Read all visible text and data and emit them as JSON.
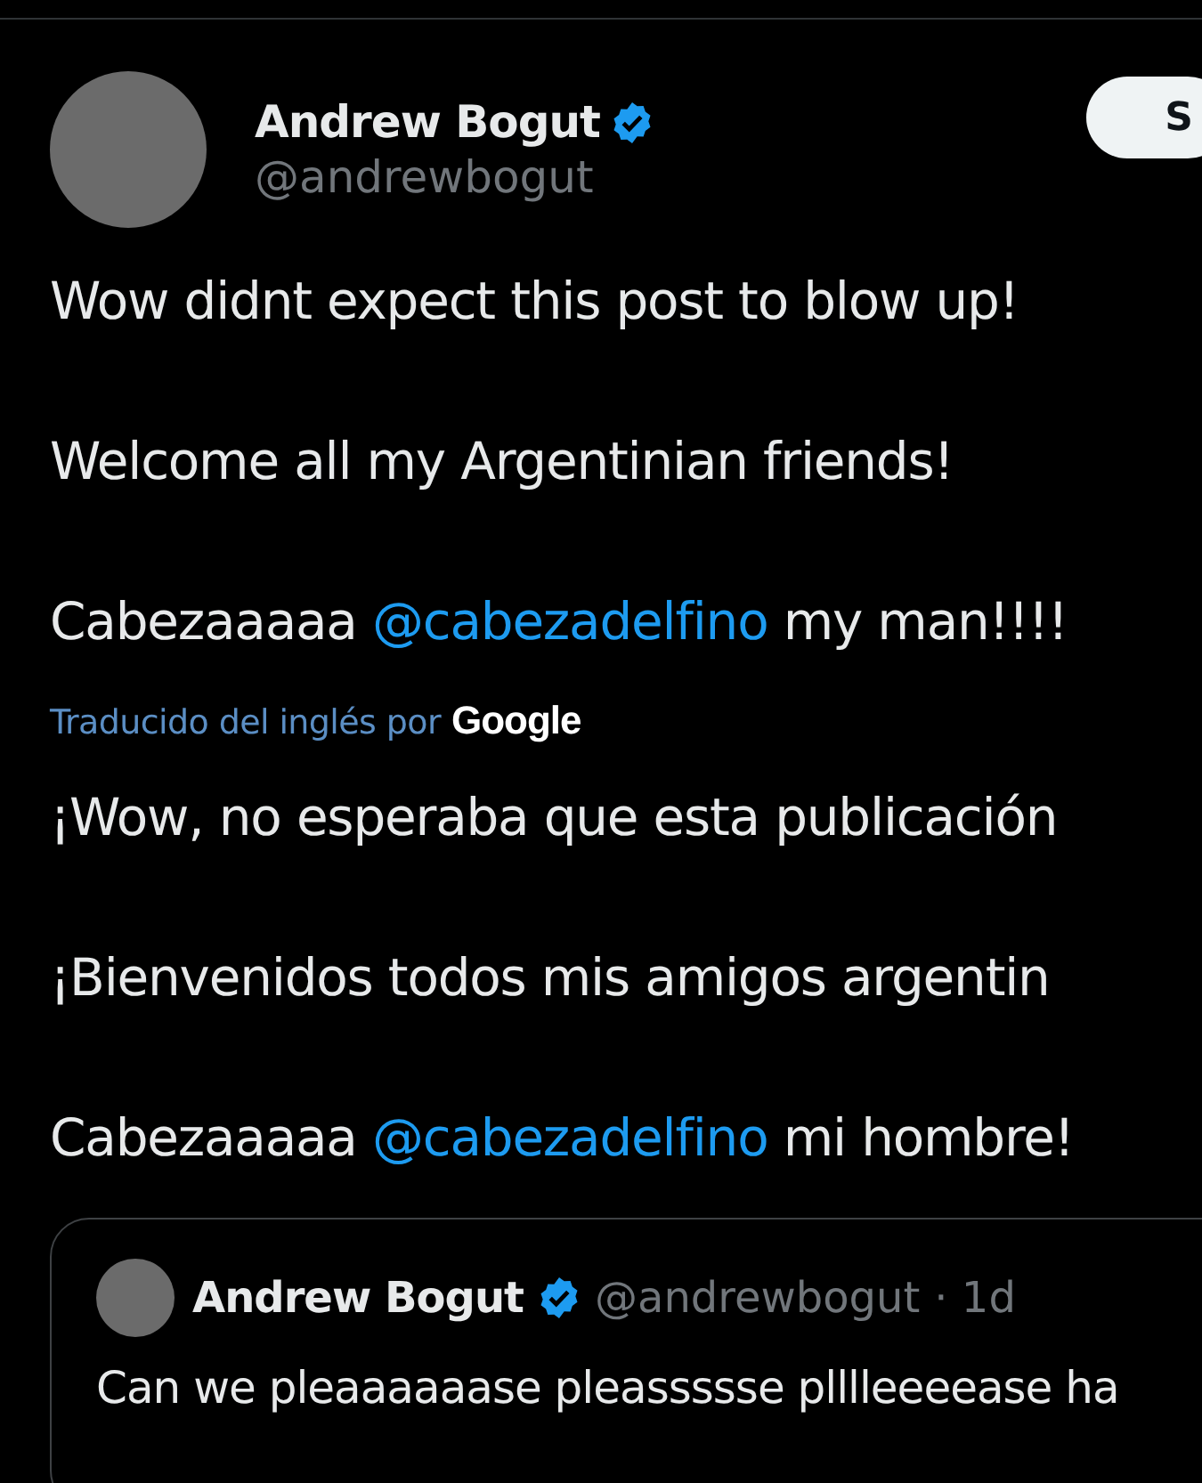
{
  "post": {
    "author": {
      "name": "Andrew Bogut",
      "verified": true,
      "handle": "@andrewbogut"
    },
    "follow_button": {
      "label": "S"
    },
    "paragraphs": [
      {
        "segments": [
          {
            "kind": "text",
            "text": "Wow didnt expect this post to blow up!"
          }
        ]
      },
      {
        "segments": [
          {
            "kind": "text",
            "text": "Welcome all my Argentinian friends!"
          }
        ]
      },
      {
        "segments": [
          {
            "kind": "text",
            "text": "Cabezaaaaa "
          },
          {
            "kind": "mention",
            "text": "@cabezadelfino"
          },
          {
            "kind": "text",
            "text": " my man!!!!"
          }
        ]
      }
    ],
    "translation_note": {
      "label": "Traducido del inglés por",
      "provider": "Google"
    },
    "translated_paragraphs": [
      {
        "segments": [
          {
            "kind": "text",
            "text": "¡Wow, no esperaba que esta publicación"
          }
        ]
      },
      {
        "segments": [
          {
            "kind": "text",
            "text": "¡Bienvenidos todos mis amigos argentin"
          }
        ]
      },
      {
        "segments": [
          {
            "kind": "text",
            "text": "Cabezaaaaa "
          },
          {
            "kind": "mention",
            "text": "@cabezadelfino"
          },
          {
            "kind": "text",
            "text": " mi hombre!"
          }
        ]
      }
    ],
    "quoted_post": {
      "author": {
        "name": "Andrew Bogut",
        "verified": true,
        "handle": "@andrewbogut",
        "time": "· 1d"
      },
      "text": "Can we pleaaaaaase pleassssse plllleeeease ha"
    }
  }
}
